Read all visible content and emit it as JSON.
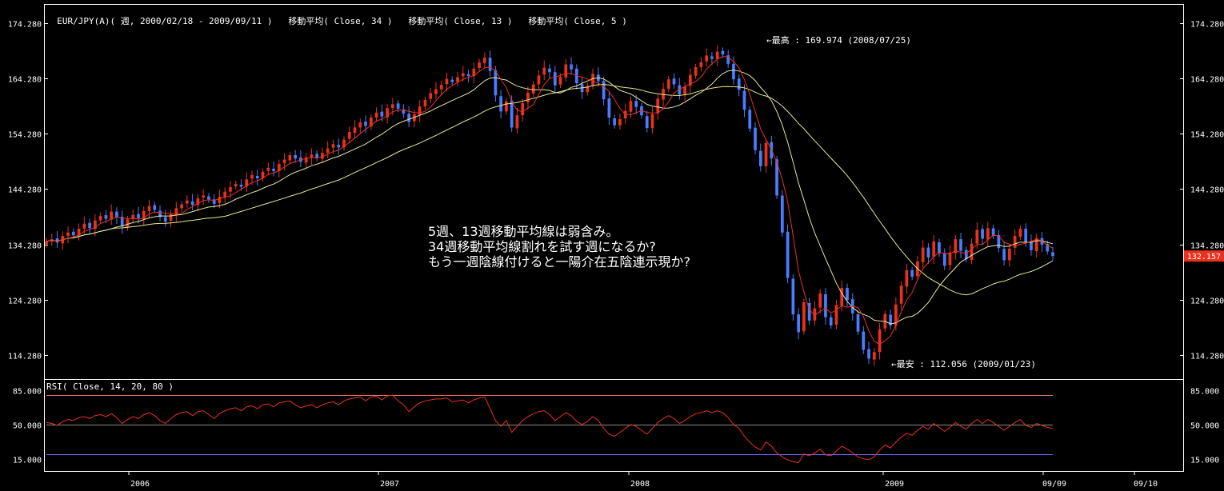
{
  "header": {
    "symbol_period": "EUR/JPY(A)( 週, 2000/02/18 - 2009/09/11 )",
    "ma34": "移動平均( Close, 34 )",
    "ma13": "移動平均( Close, 13 )",
    "ma5": "移動平均( Close, 5 )"
  },
  "rsi_header": "RSI( Close, 14, 20, 80 )",
  "annotations": {
    "high": "←最高 : 169.974 (2008/07/25)",
    "low": "←最安 : 112.056 (2009/01/23)",
    "note_lines": [
      "5週、13週移動平均線は弱含み。",
      "34週移動平均線割れを試す週になるか?",
      "もう一週陰線付けると一陽介在五陰連示現か?"
    ]
  },
  "last_price_label": "132.157",
  "colors": {
    "up": "#e8321e",
    "down": "#4a7cff",
    "ma34": "#e6e68c",
    "ma13": "#e6e6a0",
    "ma5": "#e8321e",
    "rsi": "#e8321e",
    "rsi_upper": "#e87070",
    "rsi_lower": "#6a6aff",
    "grid": "#ffffff",
    "last_price_bg": "#e8321e"
  },
  "chart_data": {
    "type": "candlestick",
    "price_axis": {
      "ticks": [
        "174.280",
        "164.280",
        "154.280",
        "144.280",
        "134.280",
        "124.280",
        "114.280"
      ],
      "tick_values": [
        174.28,
        164.28,
        154.28,
        144.28,
        134.28,
        124.28,
        114.28
      ],
      "ylim": [
        110.5,
        177
      ]
    },
    "rsi_axis": {
      "ticks": [
        "85.000",
        "50.000",
        "15.000"
      ],
      "tick_values": [
        85,
        50,
        15
      ],
      "upper": 80,
      "lower": 20,
      "ylim": [
        5,
        93
      ]
    },
    "x_axis_labels": [
      "2006",
      "2007",
      "2008",
      "2009",
      "09/09",
      "09/10"
    ],
    "weekly_close": [
      134.8,
      135.2,
      134.6,
      135.8,
      136.4,
      135.9,
      137.1,
      138.0,
      137.2,
      138.6,
      139.4,
      138.9,
      140.2,
      139.1,
      137.5,
      138.8,
      139.6,
      139.0,
      140.3,
      141.2,
      140.5,
      139.2,
      138.4,
      139.7,
      140.8,
      141.5,
      142.2,
      141.4,
      142.6,
      143.1,
      142.4,
      141.6,
      142.9,
      143.8,
      144.6,
      145.2,
      144.7,
      146.0,
      146.8,
      146.2,
      147.4,
      148.1,
      147.5,
      148.8,
      149.6,
      150.4,
      149.8,
      149.2,
      150.0,
      150.5,
      149.9,
      150.8,
      151.6,
      152.4,
      151.8,
      153.2,
      154.6,
      155.4,
      156.3,
      155.7,
      157.2,
      158.1,
      157.4,
      158.9,
      159.6,
      158.8,
      157.9,
      156.4,
      157.8,
      159.2,
      160.4,
      161.6,
      162.3,
      163.1,
      164.2,
      163.6,
      164.5,
      165.2,
      164.7,
      166.0,
      167.2,
      168.0,
      165.6,
      161.2,
      158.3,
      160.1,
      155.4,
      157.6,
      159.8,
      161.7,
      163.2,
      164.8,
      166.2,
      165.4,
      163.0,
      164.6,
      166.8,
      165.9,
      163.4,
      161.8,
      162.9,
      165.1,
      163.8,
      160.5,
      157.2,
      155.8,
      156.9,
      158.4,
      160.2,
      159.1,
      157.6,
      155.3,
      157.8,
      160.6,
      162.4,
      164.1,
      163.2,
      161.4,
      162.8,
      164.9,
      166.3,
      167.2,
      168.4,
      167.8,
      169.1,
      168.6,
      166.9,
      164.1,
      162.2,
      158.6,
      155.2,
      151.3,
      148.4,
      152.6,
      149.8,
      143.1,
      136.4,
      128.2,
      121.6,
      118.4,
      123.8,
      120.5,
      122.7,
      125.4,
      121.1,
      119.6,
      123.3,
      126.4,
      124.2,
      121.8,
      118.5,
      115.2,
      113.6,
      114.8,
      118.9,
      121.7,
      119.6,
      123.4,
      126.8,
      129.6,
      128.4,
      131.2,
      133.7,
      131.9,
      134.8,
      132.6,
      130.4,
      132.8,
      135.2,
      133.1,
      131.6,
      134.4,
      136.9,
      135.3,
      137.2,
      135.8,
      133.6,
      131.4,
      133.5,
      135.8,
      137.1,
      134.6,
      133.2,
      135.4,
      134.2,
      133.0,
      132.157
    ],
    "rsi_values": [
      52,
      51,
      49,
      53,
      55,
      54,
      57,
      58,
      56,
      59,
      60,
      58,
      61,
      57,
      51,
      55,
      58,
      56,
      60,
      62,
      59,
      54,
      51,
      56,
      60,
      62,
      63,
      59,
      63,
      64,
      60,
      56,
      61,
      64,
      66,
      67,
      64,
      68,
      69,
      66,
      70,
      71,
      68,
      72,
      73,
      74,
      70,
      67,
      69,
      70,
      67,
      70,
      72,
      73,
      70,
      74,
      76,
      77,
      78,
      74,
      78,
      79,
      75,
      79,
      80,
      74,
      70,
      63,
      68,
      72,
      74,
      75,
      76,
      76,
      77,
      73,
      74,
      75,
      72,
      75,
      77,
      78,
      66,
      54,
      48,
      54,
      42,
      48,
      54,
      58,
      61,
      63,
      64,
      60,
      54,
      58,
      62,
      59,
      53,
      50,
      53,
      58,
      54,
      46,
      40,
      38,
      42,
      46,
      50,
      48,
      44,
      40,
      46,
      52,
      56,
      59,
      56,
      51,
      54,
      58,
      61,
      62,
      64,
      62,
      64,
      62,
      57,
      50,
      46,
      38,
      32,
      27,
      24,
      32,
      28,
      21,
      17,
      14,
      12,
      11,
      20,
      18,
      21,
      25,
      19,
      18,
      23,
      28,
      25,
      21,
      17,
      15,
      14,
      17,
      24,
      29,
      26,
      32,
      37,
      41,
      39,
      44,
      48,
      45,
      51,
      47,
      43,
      47,
      52,
      48,
      45,
      51,
      55,
      51,
      55,
      52,
      48,
      44,
      48,
      52,
      55,
      49,
      47,
      51,
      49,
      47,
      46
    ]
  }
}
